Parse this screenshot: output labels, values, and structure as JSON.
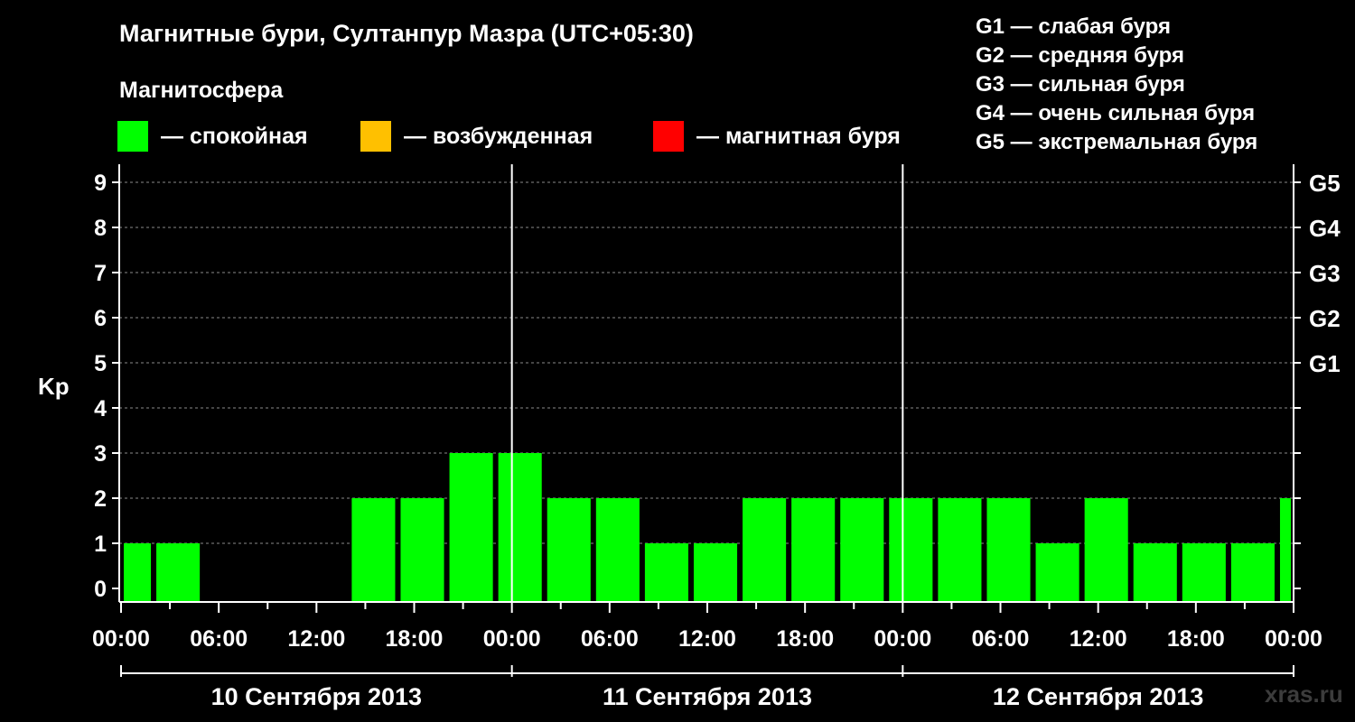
{
  "header": {
    "title": "Магнитные бури, Султанпур Мазра (UTC+05:30)",
    "subtitle": "Магнитосфера"
  },
  "legend": [
    {
      "label": "— спокойная",
      "color": "#00ff00"
    },
    {
      "label": "— возбужденная",
      "color": "#ffc000"
    },
    {
      "label": "— магнитная буря",
      "color": "#ff0000"
    }
  ],
  "storm_scale": [
    "G1 — слабая буря",
    "G2 — средняя буря",
    "G3 — сильная буря",
    "G4 — очень сильная буря",
    "G5 — экстремальная буря"
  ],
  "watermark": "xras.ru",
  "chart_data": {
    "type": "bar",
    "ylabel": "Kp",
    "ylim": [
      0,
      9
    ],
    "yticks": [
      0,
      1,
      2,
      3,
      4,
      5,
      6,
      7,
      8,
      9
    ],
    "right_axis_labels": [
      {
        "kp": 5,
        "label": "G1"
      },
      {
        "kp": 6,
        "label": "G2"
      },
      {
        "kp": 7,
        "label": "G3"
      },
      {
        "kp": 8,
        "label": "G4"
      },
      {
        "kp": 9,
        "label": "G5"
      }
    ],
    "xlim_hours": [
      0,
      72
    ],
    "x_tick_labels": [
      "00:00",
      "06:00",
      "12:00",
      "18:00",
      "00:00",
      "06:00",
      "12:00",
      "18:00",
      "00:00",
      "06:00",
      "12:00",
      "18:00",
      "00:00"
    ],
    "days": [
      "10 Сентября 2013",
      "11 Сентября 2013",
      "12 Сентября 2013"
    ],
    "bar_color": "#00ff00",
    "bars": [
      {
        "start": "00:00",
        "end": "02:00",
        "kp": 1
      },
      {
        "start": "02:00",
        "end": "05:00",
        "kp": 1
      },
      {
        "start": "05:00",
        "end": "08:00",
        "kp": 0
      },
      {
        "start": "08:00",
        "end": "11:00",
        "kp": 0
      },
      {
        "start": "11:00",
        "end": "14:00",
        "kp": 0
      },
      {
        "start": "14:00",
        "end": "17:00",
        "kp": 2
      },
      {
        "start": "17:00",
        "end": "20:00",
        "kp": 2
      },
      {
        "start": "20:00",
        "end": "23:00",
        "kp": 3
      },
      {
        "start": "23:00",
        "end": "02:00",
        "kp": 3
      },
      {
        "start": "02:00",
        "end": "05:00",
        "kp": 2
      },
      {
        "start": "05:00",
        "end": "08:00",
        "kp": 2
      },
      {
        "start": "08:00",
        "end": "11:00",
        "kp": 1
      },
      {
        "start": "11:00",
        "end": "14:00",
        "kp": 1
      },
      {
        "start": "14:00",
        "end": "17:00",
        "kp": 2
      },
      {
        "start": "17:00",
        "end": "20:00",
        "kp": 2
      },
      {
        "start": "20:00",
        "end": "23:00",
        "kp": 2
      },
      {
        "start": "23:00",
        "end": "02:00",
        "kp": 2
      },
      {
        "start": "02:00",
        "end": "05:00",
        "kp": 2
      },
      {
        "start": "05:00",
        "end": "08:00",
        "kp": 2
      },
      {
        "start": "08:00",
        "end": "11:00",
        "kp": 1
      },
      {
        "start": "11:00",
        "end": "14:00",
        "kp": 2
      },
      {
        "start": "14:00",
        "end": "17:00",
        "kp": 1
      },
      {
        "start": "17:00",
        "end": "20:00",
        "kp": 1
      },
      {
        "start": "20:00",
        "end": "23:00",
        "kp": 1
      },
      {
        "start": "23:00",
        "end": "00:00",
        "kp": 2
      }
    ]
  }
}
